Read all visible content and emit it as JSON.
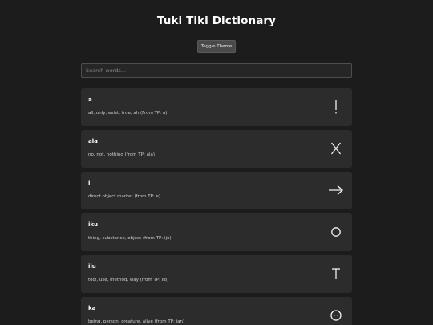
{
  "header": {
    "title": "Tuki Tiki Dictionary",
    "toggle_label": "Toggle Theme"
  },
  "search": {
    "placeholder": "Search words..."
  },
  "entries": [
    {
      "word": "a",
      "definition": "all, only, exist, true, ah (From TP: a)",
      "glyph": "exclamation-glyph-icon"
    },
    {
      "word": "ala",
      "definition": "no, not, nothing (from TP: ala)",
      "glyph": "x-glyph-icon"
    },
    {
      "word": "i",
      "definition": "direct object marker (from TP: e)",
      "glyph": "arrow-right-glyph-icon"
    },
    {
      "word": "iku",
      "definition": "thing, substance, object (from TP: ijo)",
      "glyph": "circle-glyph-icon"
    },
    {
      "word": "ilu",
      "definition": "tool, use, method, way (from TP: ilo)",
      "glyph": "t-glyph-icon"
    },
    {
      "word": "ka",
      "definition": "being, person, creature, alive (from TP: jan)",
      "glyph": "face-circle-glyph-icon"
    }
  ],
  "colors": {
    "background": "#1c1c1c",
    "card": "#2c2c2c",
    "button": "#4a4a4a"
  }
}
